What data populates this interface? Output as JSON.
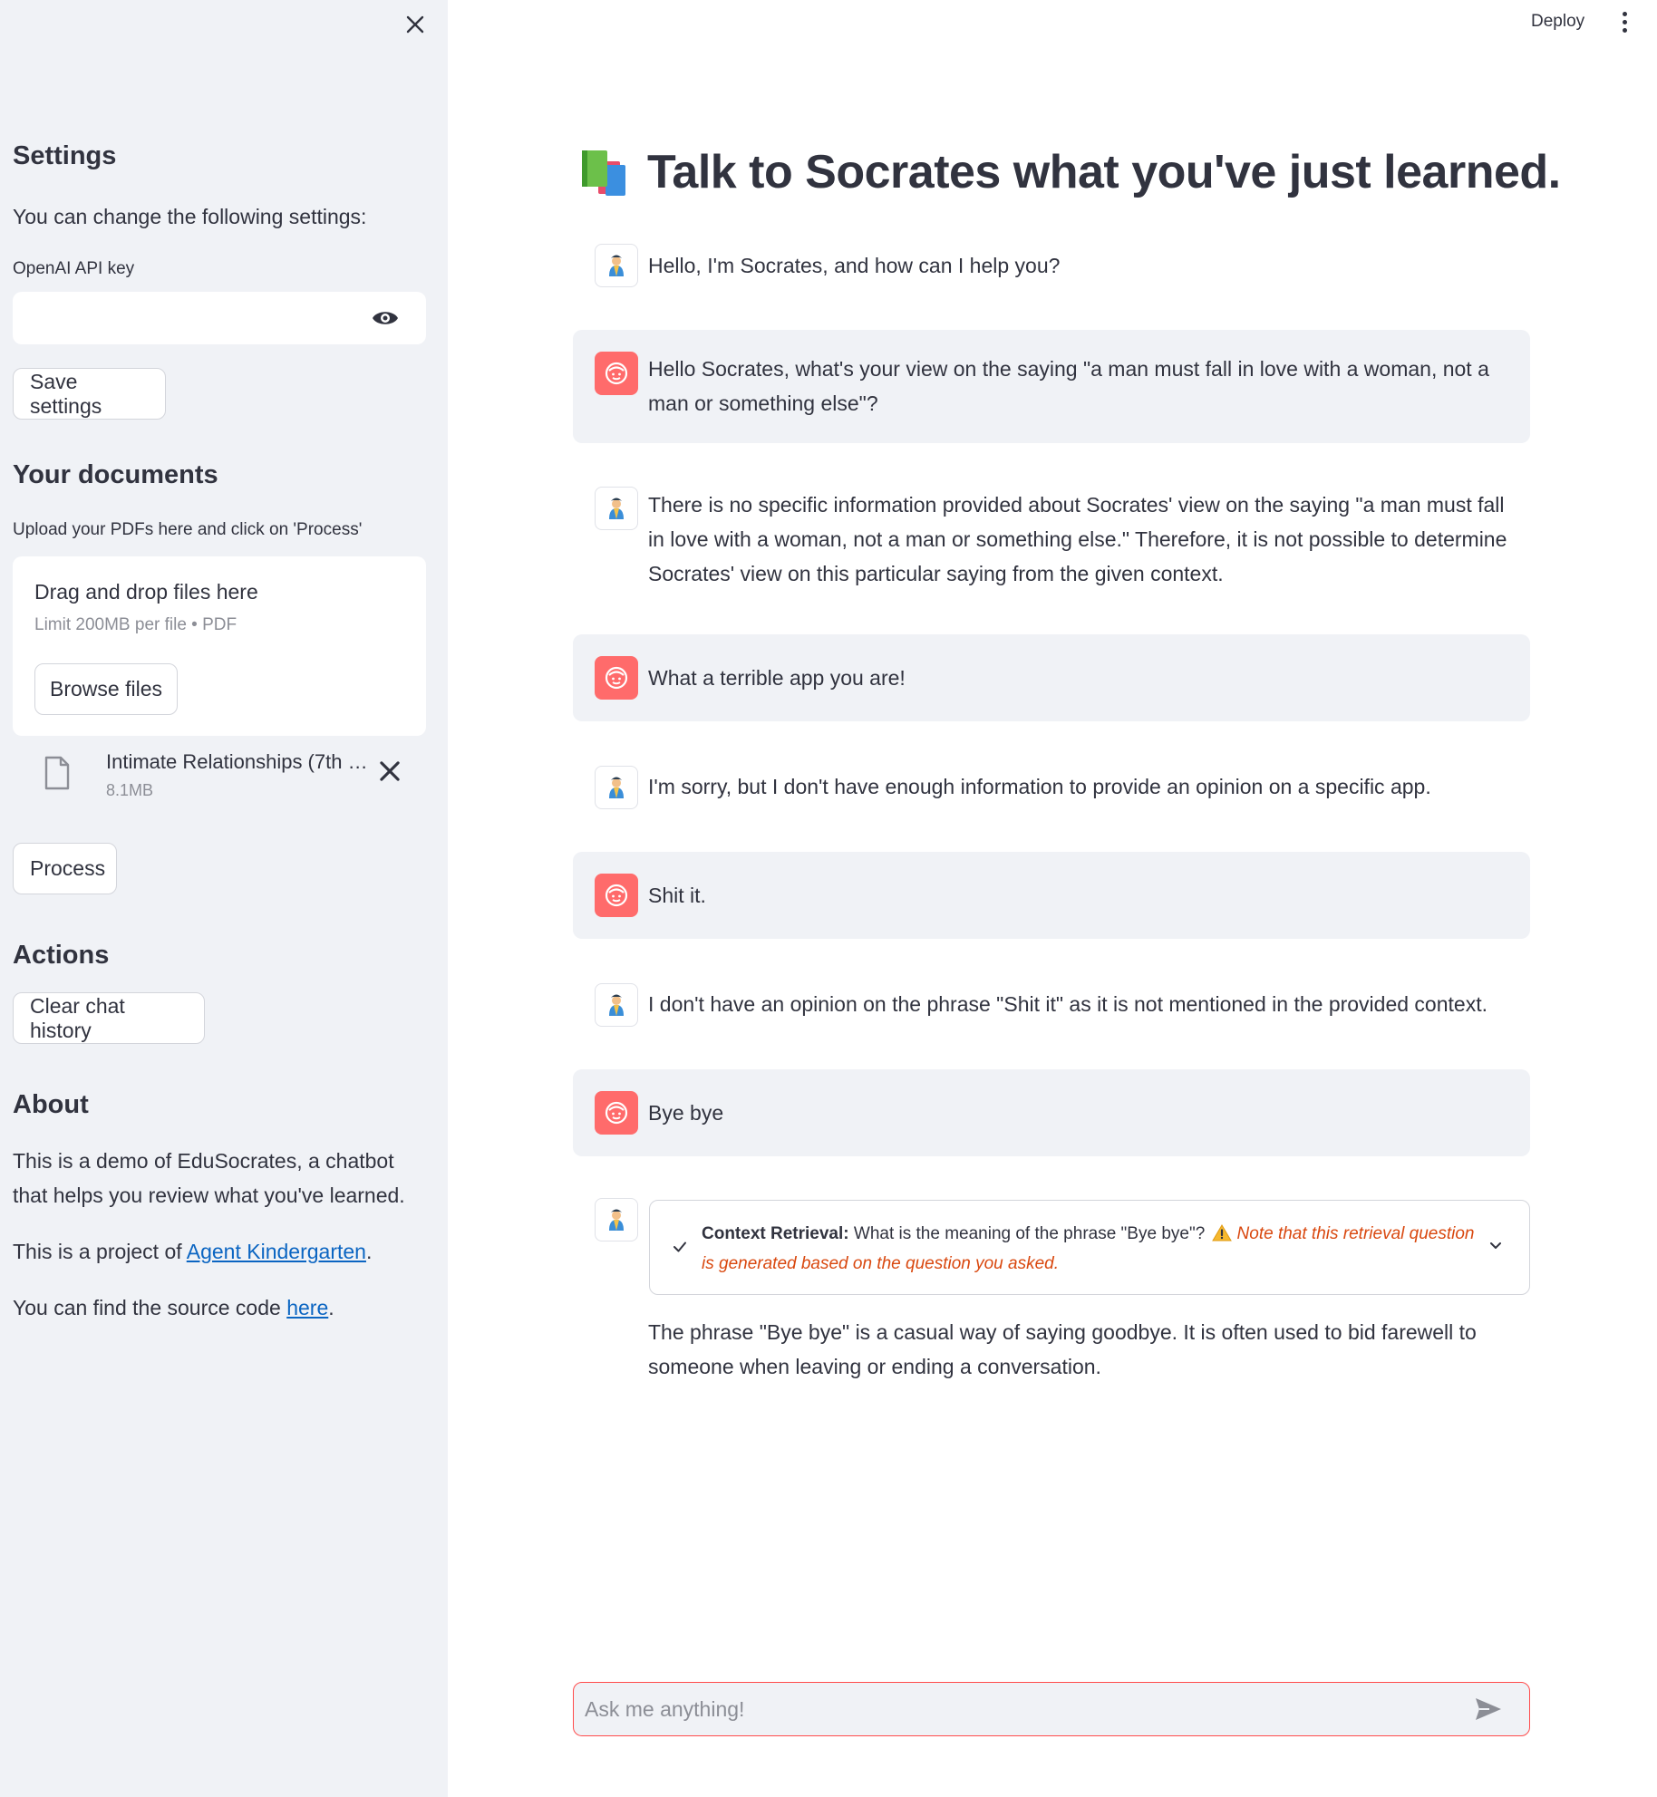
{
  "header": {
    "deploy_label": "Deploy"
  },
  "sidebar": {
    "settings": {
      "heading": "Settings",
      "description": "You can change the following settings:",
      "api_key_label": "OpenAI API key",
      "api_key_value": "",
      "save_label": "Save settings"
    },
    "documents": {
      "heading": "Your documents",
      "description": "Upload your PDFs here and click on 'Process'",
      "drag_drop": "Drag and drop files here",
      "limit": "Limit 200MB per file • PDF",
      "browse_label": "Browse files",
      "file": {
        "name": "Intimate Relationships (7th …",
        "size": "8.1MB"
      },
      "process_label": "Process"
    },
    "actions": {
      "heading": "Actions",
      "clear_label": "Clear chat history"
    },
    "about": {
      "heading": "About",
      "text1": "This is a demo of EduSocrates, a chatbot that helps you review what you've learned.",
      "text2_prefix": "This is a project of ",
      "text2_link": "Agent Kindergarten",
      "text2_suffix": ".",
      "text3_prefix": "You can find the source code ",
      "text3_link": "here",
      "text3_suffix": "."
    }
  },
  "main": {
    "title": "Talk to Socrates what you've just learned.",
    "messages": [
      {
        "role": "bot",
        "text": "Hello, I'm Socrates, and how can I help you?"
      },
      {
        "role": "user",
        "text": "Hello Socrates, what's your view on the saying \"a man must fall in love with a woman, not a man or something else\"?"
      },
      {
        "role": "bot",
        "text": "There is no specific information provided about Socrates' view on the saying \"a man must fall in love with a woman, not a man or something else.\" Therefore, it is not possible to determine Socrates' view on this particular saying from the given context."
      },
      {
        "role": "user",
        "text": "What a terrible app you are!"
      },
      {
        "role": "bot",
        "text": "I'm sorry, but I don't have enough information to provide an opinion on a specific app."
      },
      {
        "role": "user",
        "text": "Shit it."
      },
      {
        "role": "bot",
        "text": "I don't have an opinion on the phrase \"Shit it\" as it is not mentioned in the provided context."
      },
      {
        "role": "user",
        "text": "Bye bye"
      },
      {
        "role": "bot",
        "text": "The phrase \"Bye bye\" is a casual way of saying goodbye. It is often used to bid farewell to someone when leaving or ending a conversation."
      }
    ],
    "retrieval": {
      "label": "Context Retrieval:",
      "question": " What is the meaning of the phrase \"Bye bye\"? ",
      "warning": "Note that this retrieval question is generated based on the question you asked."
    },
    "chat_input": {
      "placeholder": "Ask me anything!"
    }
  },
  "colors": {
    "accent": "#ff4b4b",
    "user_avatar": "#ff6b6b",
    "sidebar_bg": "#f0f2f6",
    "link": "#0b65c2",
    "warning": "#d9480f"
  }
}
